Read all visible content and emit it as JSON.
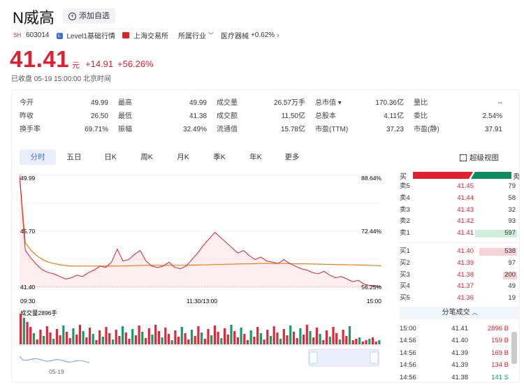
{
  "header": {
    "title": "N威高",
    "watch_label": "添加自选",
    "market_badge": "SH",
    "code": "603014",
    "level1_badge": "L",
    "level1_label": "Level1基础行情",
    "exchange": "上海交易所",
    "industry_label": "所属行业",
    "industry": "医疗器械",
    "industry_change": "+0.62%",
    "price": "41.41",
    "unit": "元",
    "change": "+14.91",
    "change_pct": "+56.26%",
    "status": "已收盘 05-19 15:00:00 北京时间"
  },
  "stats": [
    [
      {
        "label": "今开",
        "value": "49.99",
        "color": "red"
      },
      {
        "label": "最高",
        "value": "49.99",
        "color": "red"
      },
      {
        "label": "成交量",
        "value": "26.57万手",
        "color": ""
      },
      {
        "label": "总市值 ▾",
        "value": "170.36亿",
        "color": ""
      },
      {
        "label": "量比",
        "value": "--",
        "color": ""
      }
    ],
    [
      {
        "label": "昨收",
        "value": "26.50",
        "color": ""
      },
      {
        "label": "最低",
        "value": "41.38",
        "color": "red"
      },
      {
        "label": "成交额",
        "value": "11.50亿",
        "color": ""
      },
      {
        "label": "总股本",
        "value": "4.11亿",
        "color": ""
      },
      {
        "label": "委比",
        "value": "2.54%",
        "color": ""
      }
    ],
    [
      {
        "label": "换手率",
        "value": "69.71%",
        "color": ""
      },
      {
        "label": "振幅",
        "value": "32.49%",
        "color": ""
      },
      {
        "label": "流通值",
        "value": "15.78亿",
        "color": ""
      },
      {
        "label": "市盈(TTM)",
        "value": "37.23",
        "color": ""
      },
      {
        "label": "市盈(静)",
        "value": "37.91",
        "color": ""
      }
    ]
  ],
  "tabs": [
    "分时",
    "五日",
    "日K",
    "周K",
    "月K",
    "季K",
    "年K",
    "更多"
  ],
  "fullview_label": "超级视图",
  "chart": {
    "y_top": "49.99",
    "y_mid": "45.70",
    "y_bottom": "41.40",
    "pct_top": "88.64%",
    "pct_mid": "72.44%",
    "pct_bottom": "56.25%",
    "x_start": "09:30",
    "x_mid": "11:30/13:00",
    "x_end": "15:00",
    "volume_label": "成交量2896手",
    "mini_date": "05-19"
  },
  "chart_data": {
    "type": "line",
    "ylim": [
      41.38,
      49.99
    ],
    "series": [
      {
        "values": [
          49.99,
          44.2,
          43.6,
          43.1,
          42.7,
          42.5,
          42.4,
          42.2,
          42.0,
          42.1,
          42.3,
          42.2,
          42.5,
          42.7,
          43.0,
          42.9,
          43.3,
          44.3,
          43.4,
          43.5,
          43.9,
          44.2,
          43.4,
          43.0,
          42.9,
          43.0,
          43.3,
          42.9,
          42.8,
          43.0,
          43.5,
          44.0,
          44.6,
          45.1,
          45.6,
          45.2,
          44.8,
          44.4,
          44.0,
          44.2,
          43.8,
          43.5,
          43.7,
          43.4,
          43.3,
          43.2,
          43.5,
          43.2,
          43.0,
          42.8,
          42.7,
          42.5,
          42.4,
          42.6,
          42.3,
          42.1,
          42.2,
          42.0,
          41.8,
          41.9,
          41.6,
          41.5,
          41.45,
          41.41
        ]
      },
      {
        "values": [
          49.99,
          44.8,
          44.2,
          43.8,
          43.5,
          43.3,
          43.2,
          43.1,
          43.05,
          43.0,
          43.0,
          43.0,
          43.0,
          43.0,
          43.0,
          43.0,
          43.0,
          43.0,
          43.01,
          43.02,
          43.03,
          43.05,
          43.06,
          43.06,
          43.06,
          43.06,
          43.06,
          43.06,
          43.06,
          43.06,
          43.07,
          43.08,
          43.09,
          43.1,
          43.12,
          43.13,
          43.14,
          43.15,
          43.16,
          43.17,
          43.18,
          43.19,
          43.2,
          43.2,
          43.2,
          43.2,
          43.2,
          43.19,
          43.18,
          43.18,
          43.17,
          43.16,
          43.15,
          43.14,
          43.13,
          43.12,
          43.11,
          43.1,
          43.09,
          43.08,
          43.07,
          43.06,
          43.04,
          43.02
        ]
      }
    ]
  },
  "orderbook": {
    "buy_head": "买",
    "sell_head": "卖",
    "sells": [
      {
        "name": "卖5",
        "price": "41.45",
        "vol": "79"
      },
      {
        "name": "卖4",
        "price": "41.44",
        "vol": "58"
      },
      {
        "name": "卖3",
        "price": "41.43",
        "vol": "32"
      },
      {
        "name": "卖2",
        "price": "41.42",
        "vol": "93"
      },
      {
        "name": "卖1",
        "price": "41.41",
        "vol": "597"
      }
    ],
    "buys": [
      {
        "name": "买1",
        "price": "41.40",
        "vol": "538"
      },
      {
        "name": "买2",
        "price": "41.39",
        "vol": "97"
      },
      {
        "name": "买3",
        "price": "41.38",
        "vol": "200"
      },
      {
        "name": "买4",
        "price": "41.37",
        "vol": "49"
      },
      {
        "name": "买5",
        "price": "41.36",
        "vol": "19"
      }
    ],
    "trades_title": "分笔成交",
    "trades": [
      {
        "time": "15:00",
        "price": "41.41",
        "vol": "2896 B"
      },
      {
        "time": "14:56",
        "price": "41.40",
        "vol": "159 B"
      },
      {
        "time": "14:56",
        "price": "41.39",
        "vol": "169 B"
      },
      {
        "time": "14:56",
        "price": "41.39",
        "vol": "134 B"
      },
      {
        "time": "14:56",
        "price": "41.38",
        "vol": "141 S"
      }
    ]
  },
  "colors": {
    "up": "#e0202f",
    "down": "#0f9d58",
    "avg": "#f07c1a",
    "accent": "#3b6fe0"
  }
}
